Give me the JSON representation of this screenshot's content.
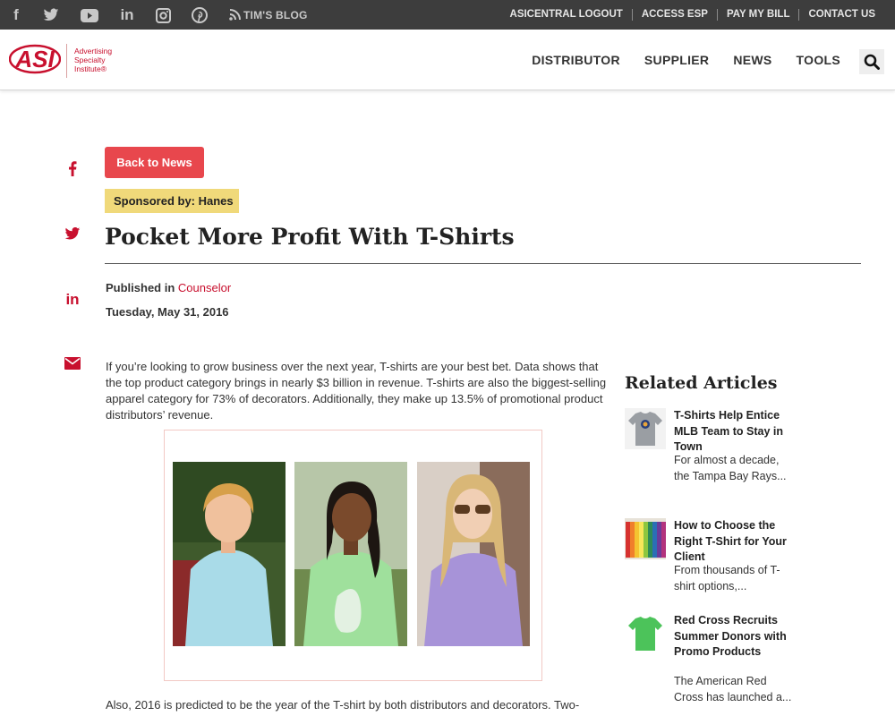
{
  "topbar": {
    "social": [
      "facebook-icon",
      "twitter-icon",
      "youtube-icon",
      "linkedin-icon",
      "instagram-icon",
      "pinterest-icon"
    ],
    "blog_label": "TIM'S BLOG",
    "links": [
      "ASICENTRAL LOGOUT",
      "ACCESS ESP",
      "PAY MY BILL",
      "CONTACT US"
    ]
  },
  "header": {
    "logo_text": [
      "Advertising",
      "Specialty",
      "Institute®"
    ],
    "nav": [
      "DISTRIBUTOR",
      "SUPPLIER",
      "NEWS",
      "TOOLS"
    ]
  },
  "colors": {
    "brand_red": "#c8102e",
    "button_red": "#e8474d",
    "sponsor_yellow": "#f0d97a",
    "topbar": "#3d3d3d"
  },
  "article": {
    "back_label": "Back to News",
    "sponsor": "Sponsored by: Hanes",
    "title": "Pocket More Profit With T-Shirts",
    "published_prefix": "Published in",
    "published_in": "Counselor",
    "date": "Tuesday, May 31, 2016",
    "paragraph1": "If you’re looking to grow business over the next year, T-shirts are your best bet. Data shows that the top product category brings in nearly $3 billion in revenue. T-shirts are also the biggest-selling apparel category for 73% of decorators. Additionally, they make up 13.5% of promotional product distributors’ revenue.",
    "paragraph2": "Also, 2016 is predicted to be the year of the T-shirt by both distributors and decorators. Two-"
  },
  "share": [
    "facebook-icon",
    "twitter-icon",
    "linkedin-icon",
    "email-icon"
  ],
  "related": {
    "title": "Related Articles",
    "items": [
      {
        "headline": "T-Shirts Help Entice MLB Team to Stay in Town",
        "desc": "For almost a decade, the Tampa Bay Rays..."
      },
      {
        "headline": "How to Choose the Right T-Shirt for Your Client",
        "desc": "From thousands of T-shirt options,..."
      },
      {
        "headline": "Red Cross Recruits Summer Donors with Promo Products",
        "desc": "The American Red Cross has launched a..."
      }
    ]
  }
}
